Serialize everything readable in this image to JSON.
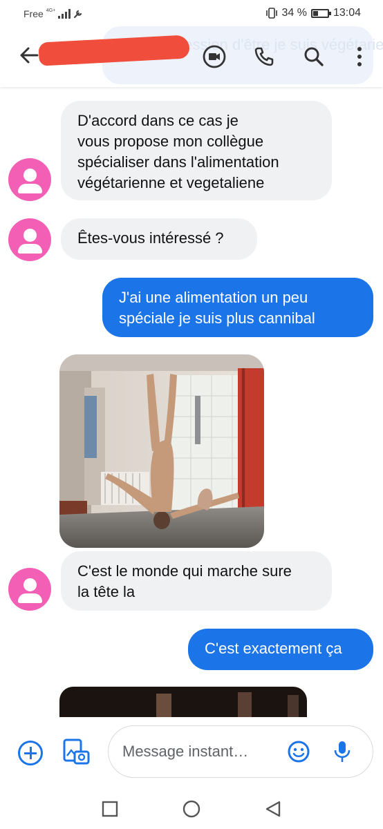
{
  "status_bar": {
    "carrier": "Free",
    "network": "4G+",
    "battery_text": "34 %",
    "battery_level": 0.34,
    "time": "13:04"
  },
  "header": {
    "ghost_preview_text": "J'ai l'impression d'être je suis végétarien",
    "icons": [
      "back-arrow-icon",
      "video-call-icon",
      "phone-icon",
      "search-icon",
      "more-vert-icon"
    ]
  },
  "messages": [
    {
      "direction": "incoming",
      "lines": [
        "D'accord dans ce cas je",
        "vous propose mon collègue",
        "spécialiser dans l'alimentation",
        "végétarienne et vegetaliene"
      ]
    },
    {
      "direction": "incoming",
      "lines": [
        "Êtes-vous intéressé ?"
      ]
    },
    {
      "direction": "outgoing",
      "lines": [
        "J'ai une alimentation un peu",
        "spéciale je suis plus cannibal"
      ]
    },
    {
      "direction": "incoming",
      "type": "image"
    },
    {
      "direction": "incoming",
      "lines": [
        "C'est le monde qui marche sure",
        "la tête la"
      ]
    },
    {
      "direction": "outgoing",
      "lines": [
        "C'est exactement ça"
      ]
    },
    {
      "direction": "incoming",
      "type": "image"
    }
  ],
  "composer": {
    "placeholder": "Message instant…",
    "icons": [
      "add-icon",
      "gallery-camera-icon",
      "emoji-icon",
      "microphone-icon"
    ]
  },
  "nav": {
    "icons": [
      "recents-square-icon",
      "home-circle-icon",
      "back-triangle-icon"
    ]
  },
  "colors": {
    "accent": "#1b74e8",
    "incoming_bubble": "#f0f1f3",
    "avatar": "#f45fb6",
    "redaction": "#f04d3c"
  }
}
